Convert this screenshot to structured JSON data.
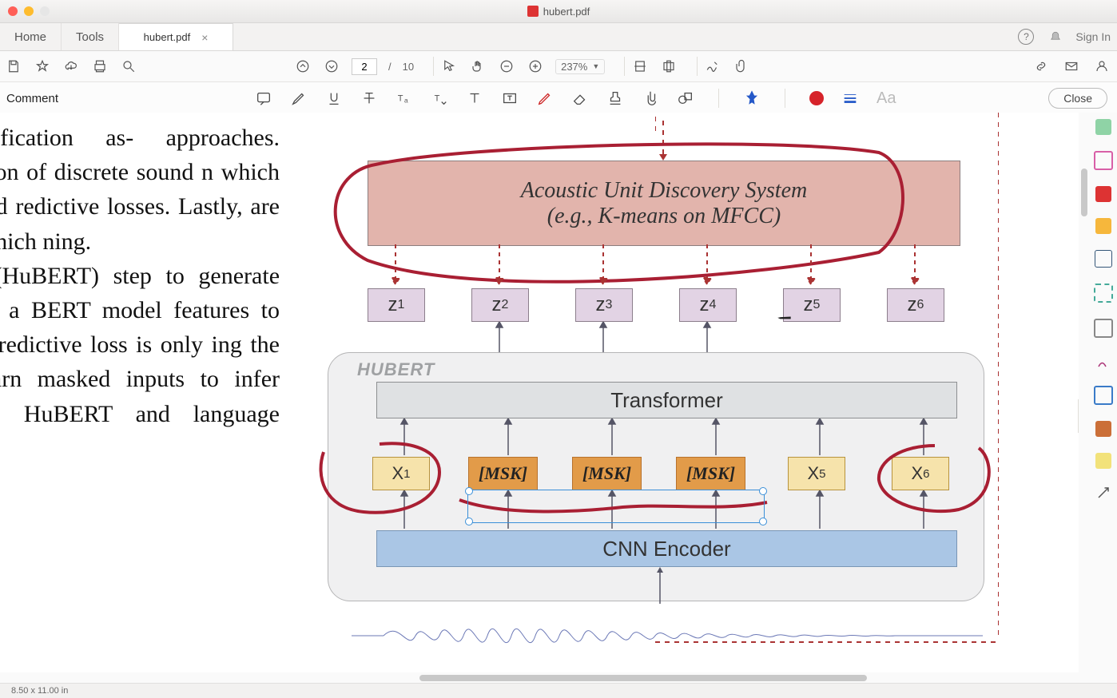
{
  "window": {
    "title": "hubert.pdf"
  },
  "tabs": {
    "home": "Home",
    "tools": "Tools",
    "file": "hubert.pdf",
    "signin": "Sign In"
  },
  "toolbar": {
    "page_current": "2",
    "page_total": "10",
    "page_sep": "/",
    "zoom": "237%"
  },
  "comment": {
    "label": "Comment",
    "close": "Close",
    "aa": "Aa"
  },
  "status": {
    "dims": "8.50 x 11.00 in"
  },
  "figure": {
    "aud_line1": "Acoustic Unit Discovery System",
    "aud_line2": "(e.g., K-means on MFCC)",
    "z": [
      "z",
      "z",
      "z",
      "z",
      "z",
      "z"
    ],
    "hubert": "HUBERT",
    "transformer": "Transformer",
    "row": {
      "x1": "X",
      "msk": "[MSK]",
      "x5": "X",
      "x6": "X"
    },
    "cnn": "CNN Encoder"
  },
  "paper_text": "tance classification as- approaches. Secondly, xicon of discrete sound n which words or word redictive losses. Lastly, are not known, which ning.\nunit BERT (HuBERT) step to generate noisy cretely, a BERT model features to predict pre- predictive loss is only ing the model to learn masked inputs to infer tuitively, the HuBERT and language models"
}
